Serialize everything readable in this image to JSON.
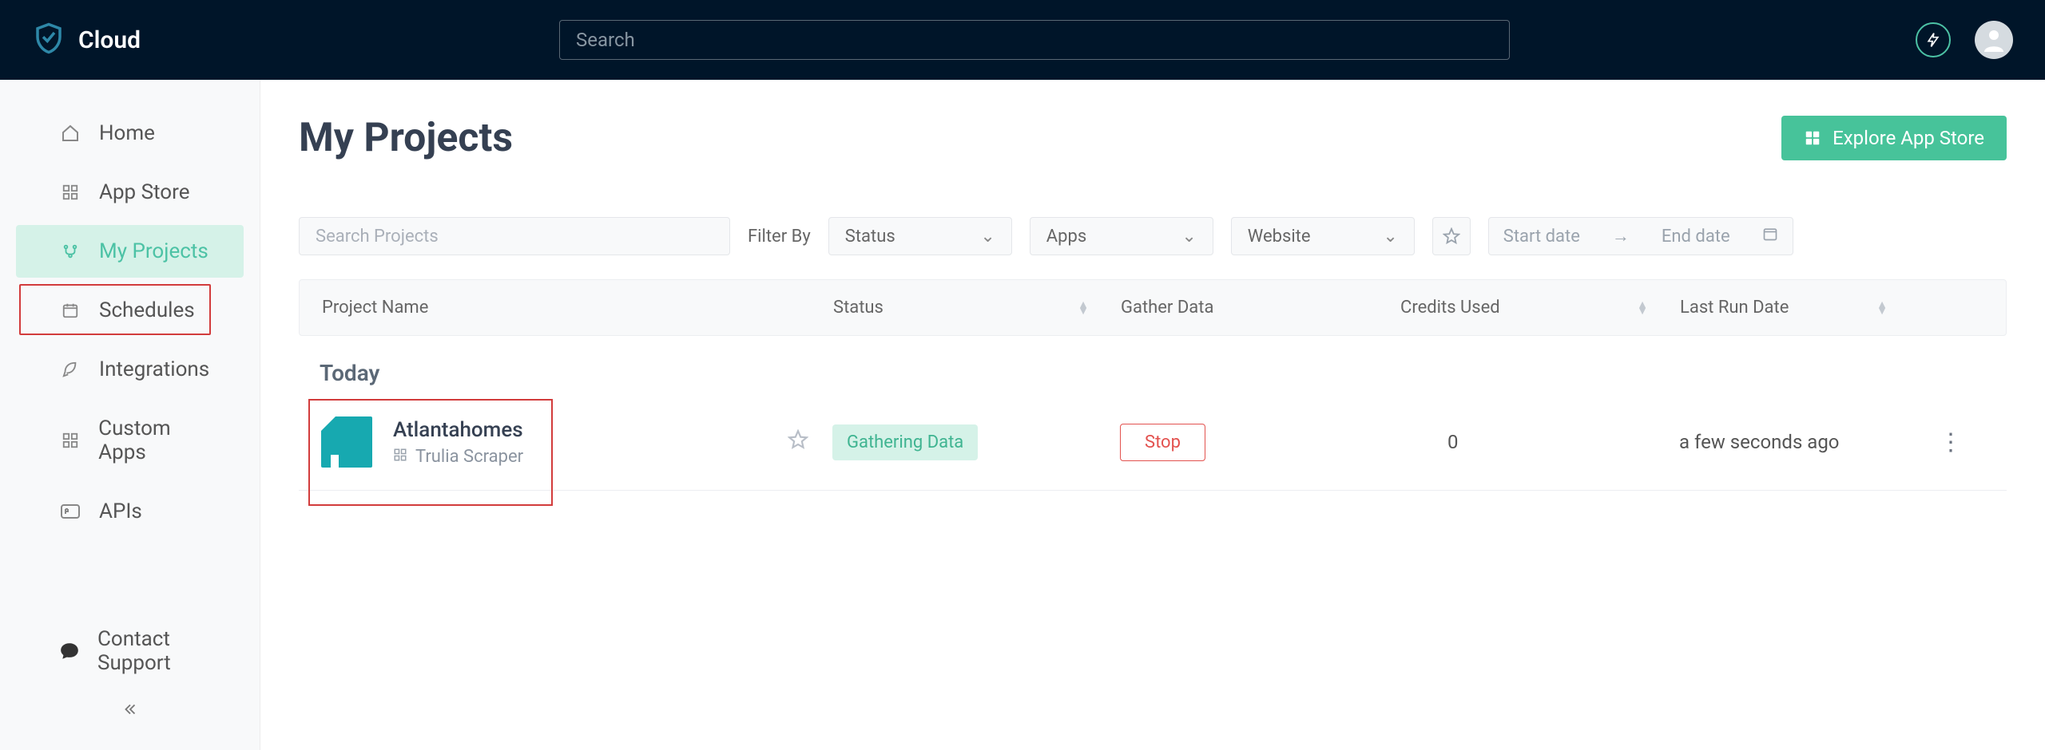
{
  "header": {
    "brand": "Cloud",
    "search_placeholder": "Search"
  },
  "sidebar": {
    "items": [
      {
        "label": "Home",
        "icon": "home-icon"
      },
      {
        "label": "App Store",
        "icon": "grid-icon"
      },
      {
        "label": "My Projects",
        "icon": "branch-icon",
        "active": true
      },
      {
        "label": "Schedules",
        "icon": "calendar-icon"
      },
      {
        "label": "Integrations",
        "icon": "rocket-icon"
      },
      {
        "label": "Custom Apps",
        "icon": "grid-icon"
      },
      {
        "label": "APIs",
        "icon": "api-icon"
      }
    ],
    "contact": "Contact Support"
  },
  "page": {
    "title": "My Projects",
    "explore_label": "Explore App Store"
  },
  "filters": {
    "search_placeholder": "Search Projects",
    "filter_by": "Filter By",
    "status": "Status",
    "apps": "Apps",
    "website": "Website",
    "start_date": "Start date",
    "end_date": "End date"
  },
  "columns": {
    "name": "Project Name",
    "status": "Status",
    "gather": "Gather Data",
    "credits": "Credits Used",
    "last_run": "Last Run Date"
  },
  "section": "Today",
  "row": {
    "name": "Atlantahomes",
    "source": "Trulia Scraper",
    "status": "Gathering Data",
    "action": "Stop",
    "credits": "0",
    "last_run": "a few seconds ago"
  }
}
